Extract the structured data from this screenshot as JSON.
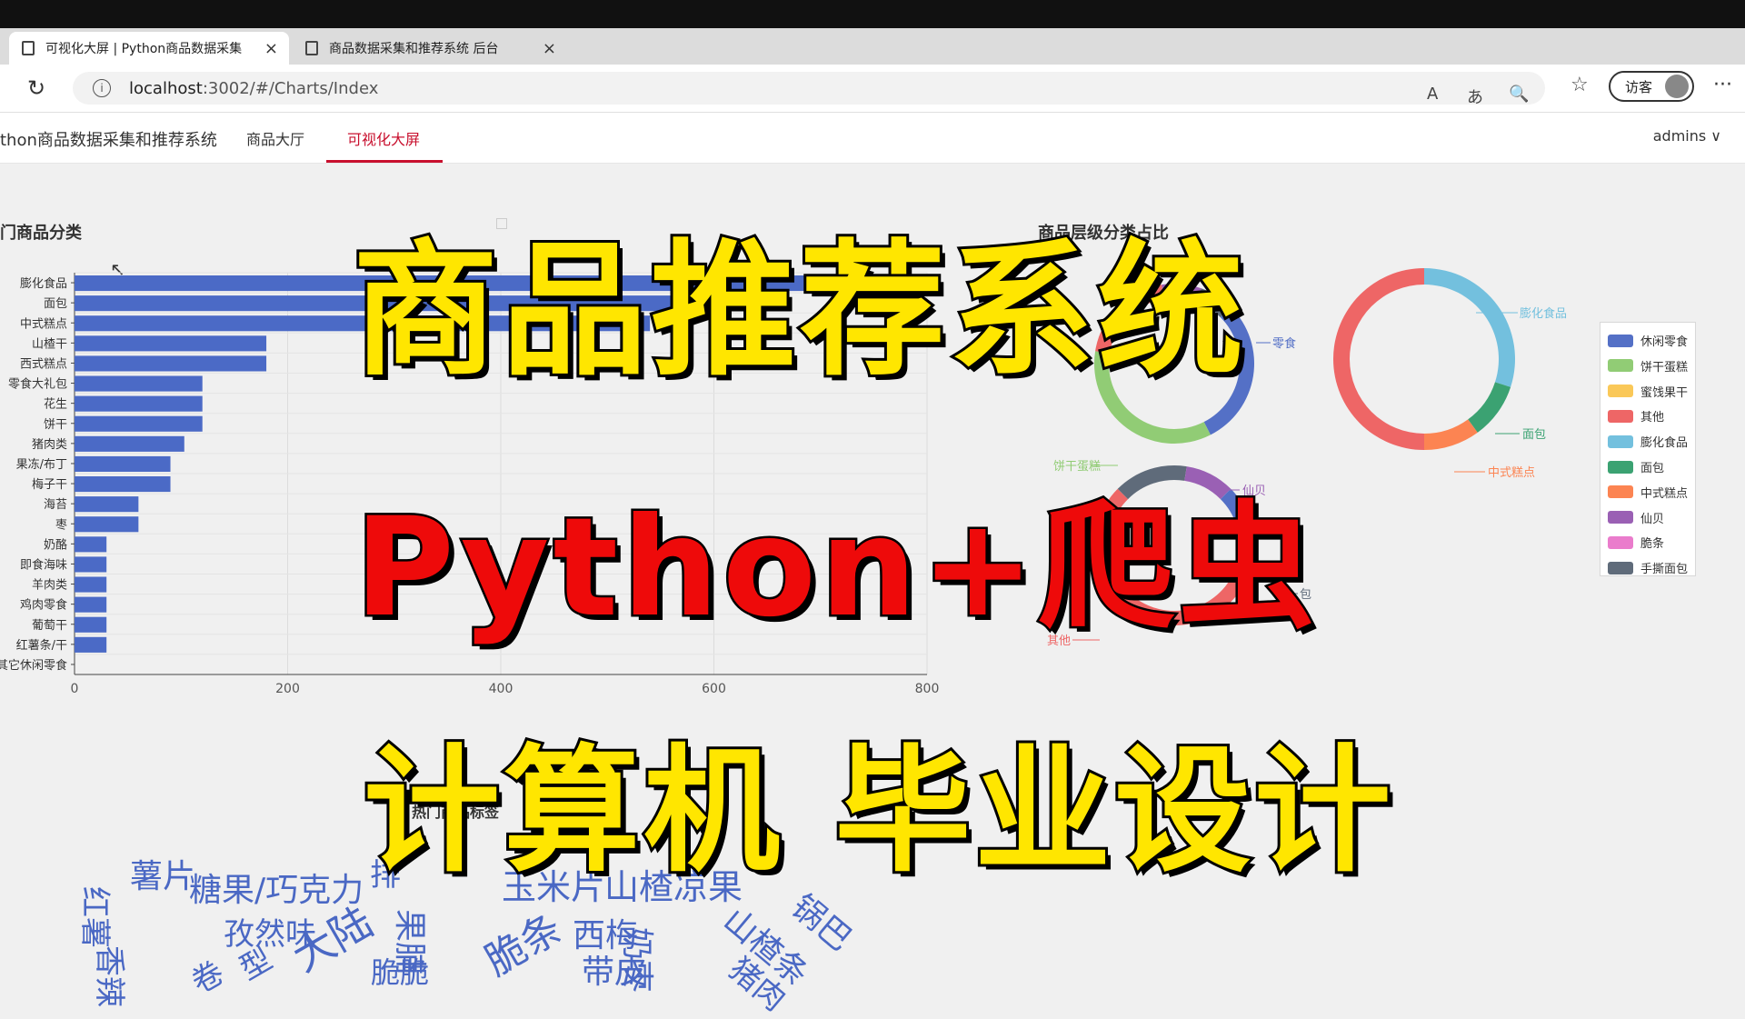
{
  "browser": {
    "tabs": [
      {
        "title": "可视化大屏 | Python商品数据采集",
        "active": true
      },
      {
        "title": "商品数据采集和推荐系统 后台",
        "active": false
      }
    ],
    "new_tab_label": "+",
    "url_host": "localhost",
    "url_rest": ":3002/#/Charts/Index",
    "guest_label": "访客",
    "window_controls": {
      "minimize": "—",
      "restore": "❐",
      "close": "✕"
    },
    "icons": {
      "read_aloud": "A",
      "translate": "あ",
      "zoom": "🔍",
      "favorites": "☆",
      "more": "···"
    }
  },
  "app_nav": {
    "brand": "thon商品数据采集和推荐系统",
    "items": [
      "商品大厅",
      "可视化大屏"
    ],
    "active_index": 1,
    "user": "admins ∨"
  },
  "bar_chart_title": "门商品分类",
  "donut_chart_title": "商品层级分类占比",
  "wordcloud_title": "热门商品标签",
  "chart_data": [
    {
      "type": "bar",
      "orientation": "horizontal",
      "categories": [
        "膨化食品",
        "面包",
        "中式糕点",
        "山楂干",
        "西式糕点",
        "零食大礼包",
        "花生",
        "饼干",
        "猪肉类",
        "果冻/布丁",
        "梅子干",
        "海苔",
        "枣",
        "奶酪",
        "即食海味",
        "羊肉类",
        "鸡肉零食",
        "葡萄干",
        "红薯条/干",
        "其它休闲零食"
      ],
      "values": [
        800,
        560,
        540,
        180,
        180,
        120,
        120,
        120,
        103,
        90,
        90,
        60,
        60,
        30,
        30,
        30,
        30,
        30,
        30,
        0
      ],
      "xlim": [
        0,
        800
      ],
      "xticks": [
        0,
        200,
        400,
        600,
        800
      ],
      "color": "#4b6ac6",
      "grid": true
    },
    {
      "type": "pie",
      "variant": "donut",
      "rings": [
        {
          "name": "inner",
          "slices": [
            {
              "label": "休闲零食",
              "value": 30
            },
            {
              "label": "饼干蛋糕",
              "value": 35
            },
            {
              "label": "其他",
              "value": 20
            },
            {
              "label": "仙贝",
              "value": 8
            },
            {
              "label": "手撕面包",
              "value": 7
            }
          ]
        },
        {
          "name": "outer",
          "slices": [
            {
              "label": "膨化食品",
              "value": 30
            },
            {
              "label": "面包",
              "value": 10
            },
            {
              "label": "中式糕点",
              "value": 10
            },
            {
              "label": "其他",
              "value": 50
            }
          ]
        }
      ],
      "legend": [
        "休闲零食",
        "饼干蛋糕",
        "蜜饯果干",
        "其他",
        "膨化食品",
        "面包",
        "中式糕点",
        "仙贝",
        "脆条",
        "手撕面包"
      ],
      "legend_position": "right",
      "colors": {
        "休闲零食": "#5470c6",
        "饼干蛋糕": "#91cc75",
        "蜜饯果干": "#fac858",
        "其他": "#ee6666",
        "膨化食品": "#73c0de",
        "面包": "#3ba272",
        "中式糕点": "#fc8452",
        "仙贝": "#9a60b4",
        "脆条": "#ea7ccc",
        "手撕面包": "#5f6b7a"
      },
      "callout_labels": [
        "膨化食品",
        "面包",
        "中式糕点",
        "仙贝",
        "其他",
        "饼干蛋糕",
        "零食",
        "包"
      ]
    }
  ],
  "wordcloud": {
    "words": [
      "薯片",
      "糖果/巧克力",
      "排",
      "孜然味",
      "红薯",
      "大陆",
      "脆脆",
      "果脯",
      "脆条",
      "西梅",
      "带皮",
      "山楂条",
      "奶枣",
      "猪肉",
      "锅巴",
      "玉米片",
      "山楂凉果",
      "香辣",
      "卷",
      "型"
    ]
  },
  "overlay": {
    "line1": "商品推荐系统",
    "line2": "Python+爬虫",
    "line3": "计算机  毕业设计"
  }
}
